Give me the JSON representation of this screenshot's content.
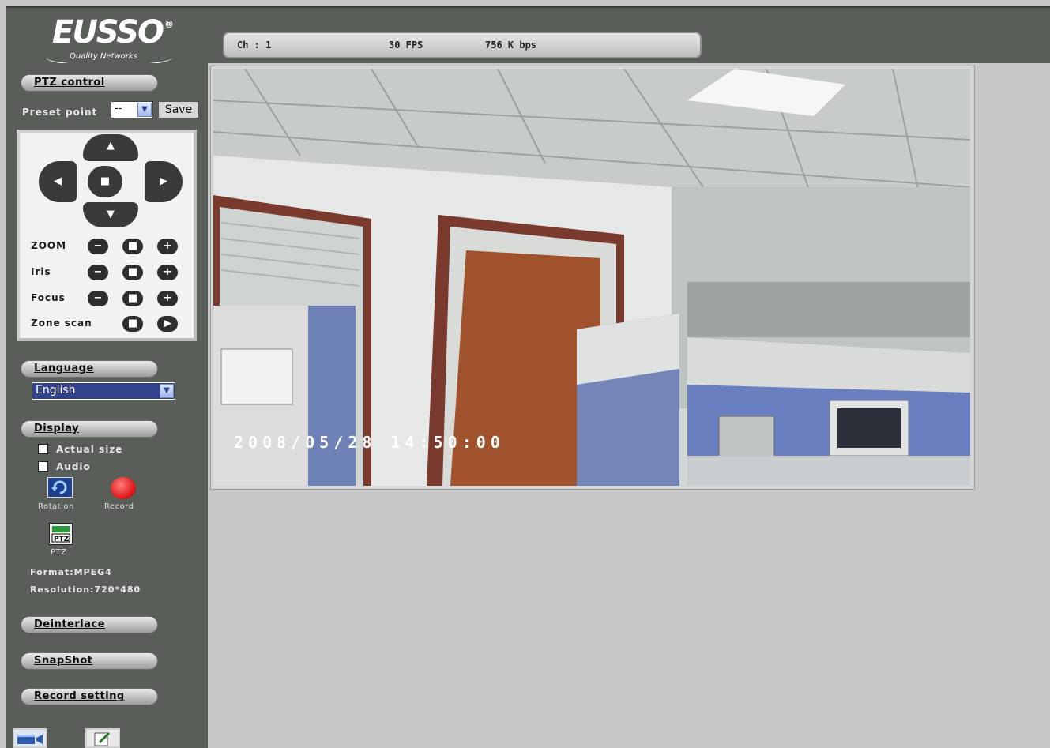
{
  "header": {
    "logo": {
      "brand": "EUSSO",
      "registered": "®",
      "tagline": "Quality Networks"
    },
    "status": {
      "channel": "Ch : 1",
      "fps": "30  FPS",
      "bitrate": "756  K bps"
    }
  },
  "sidebar": {
    "ptz": {
      "title": "PTZ control",
      "preset_label": "Preset point",
      "preset_value": "--",
      "save_label": "Save",
      "zoom_label": "ZOOM",
      "iris_label": "Iris",
      "focus_label": "Focus",
      "zone_label": "Zone scan",
      "minus": "−",
      "plus": "+",
      "stop": "■",
      "play": "▶",
      "arrow_up": "▲",
      "arrow_down": "▼",
      "arrow_left": "◀",
      "arrow_right": "▶",
      "center": "■"
    },
    "language": {
      "title": "Language",
      "selected": "English"
    },
    "display": {
      "title": "Display",
      "actual_size": "Actual size",
      "audio": "Audio",
      "rotation": "Rotation",
      "record": "Record",
      "ptz": "PTZ",
      "ptz_icon_text": "PTZ",
      "format": "Format:MPEG4",
      "resolution": "Resolution:720*480"
    },
    "deinterlace": "Deinterlace",
    "snapshot": "SnapShot",
    "record_setting": "Record setting"
  },
  "video": {
    "osd_timestamp": "2008/05/28  14:50:00"
  },
  "icons": {
    "dropdown": "chevron-down-icon",
    "rotation": "rotation-icon",
    "record": "record-icon",
    "ptz": "ptz-icon",
    "bottom_left": "video-settings-icon",
    "bottom_right": "edit-icon"
  },
  "colors": {
    "sidebar_bg": "#595e59",
    "page_bg": "#c8c8c8",
    "record_red": "#e02020",
    "select_blue": "#31428a"
  }
}
